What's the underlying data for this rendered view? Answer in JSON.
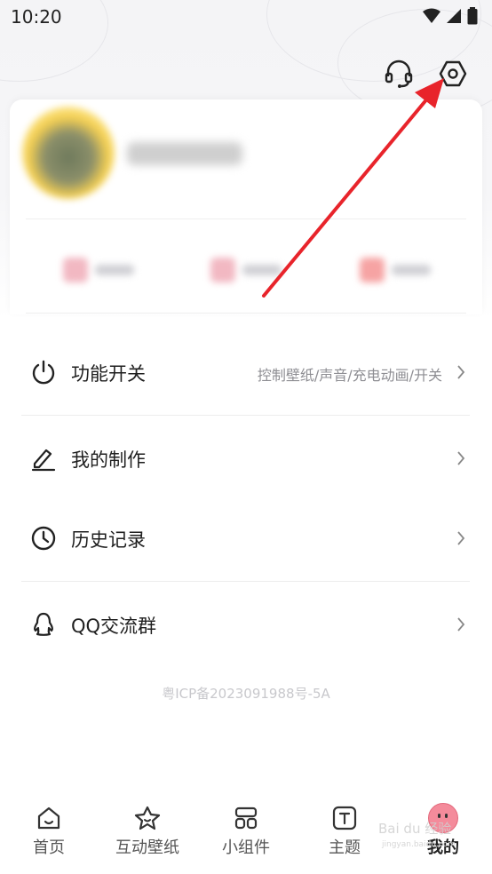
{
  "status_bar": {
    "time": "10:20"
  },
  "header": {
    "support_icon": "headset-icon",
    "settings_icon": "settings-hexagon-icon"
  },
  "menu": {
    "items": [
      {
        "label": "功能开关",
        "desc": "控制壁纸/声音/充电动画/开关",
        "icon": "power-icon"
      },
      {
        "label": "我的制作",
        "desc": "",
        "icon": "edit-pen-icon"
      },
      {
        "label": "历史记录",
        "desc": "",
        "icon": "clock-icon"
      },
      {
        "label": "QQ交流群",
        "desc": "",
        "icon": "qq-penguin-icon"
      }
    ]
  },
  "footer": {
    "icp": "粤ICP备2023091988号-5A"
  },
  "tabbar": {
    "tabs": [
      {
        "label": "首页",
        "icon": "home-icon"
      },
      {
        "label": "互动壁纸",
        "icon": "star-icon"
      },
      {
        "label": "小组件",
        "icon": "widget-grid-icon"
      },
      {
        "label": "主题",
        "icon": "theme-t-icon"
      },
      {
        "label": "我的",
        "icon": "pig-face-icon",
        "active": true
      }
    ]
  },
  "watermark": {
    "text": "Bai du 经验",
    "sub": "jingyan.baidu.com"
  },
  "colors": {
    "annotation_arrow": "#e8242b",
    "accent_pink": "#f48b9b",
    "muted_text": "#8e8e93"
  }
}
